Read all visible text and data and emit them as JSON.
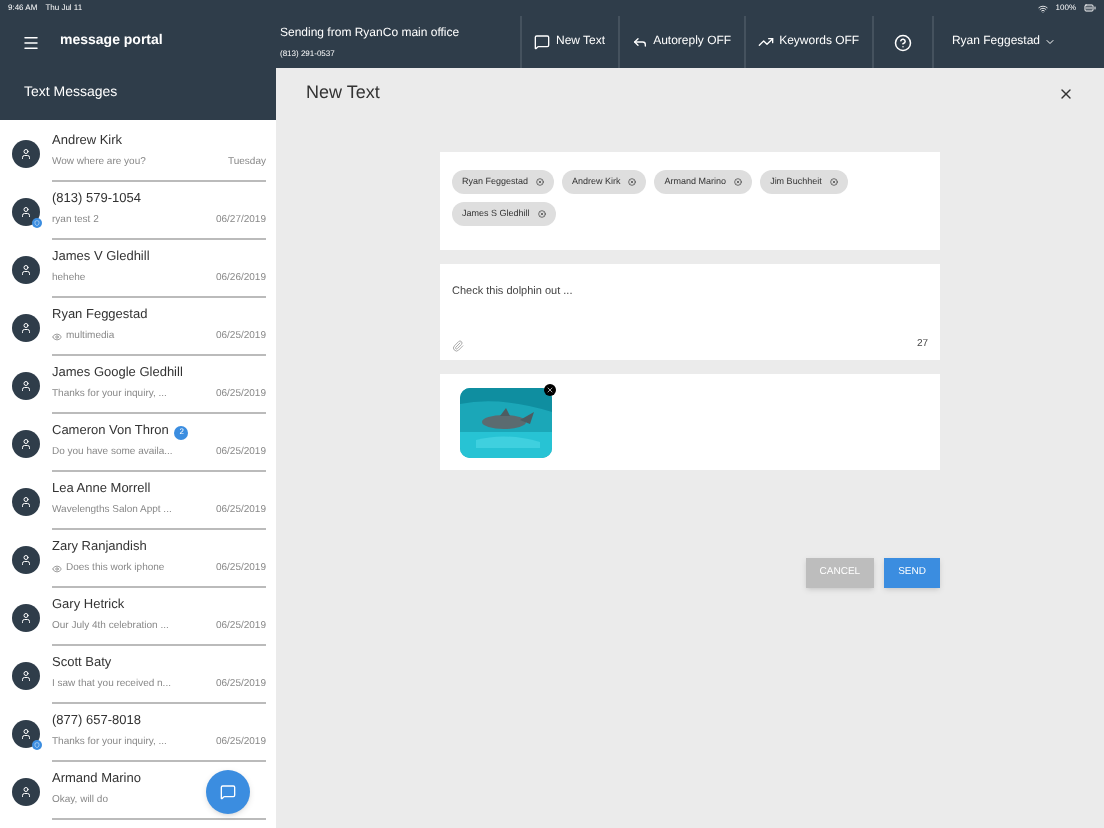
{
  "status_bar": {
    "time": "9:46 AM",
    "date": "Thu Jul 11",
    "battery": "100%"
  },
  "header": {
    "logo": "message portal",
    "sending_from": "Sending from RyanCo main office",
    "phone": "(813) 291-0537",
    "nav": [
      {
        "kind": "chat",
        "label": "New Text"
      },
      {
        "kind": "reply",
        "label": "Autoreply OFF"
      },
      {
        "kind": "keywords",
        "label": "Keywords OFF"
      }
    ],
    "user": "Ryan Feggestad"
  },
  "sidebar": {
    "title": "Text Messages",
    "items": [
      {
        "name": "Andrew Kirk",
        "preview": "Wow where are you?",
        "date": "Tuesday",
        "badge": false,
        "media": false
      },
      {
        "name": "(813) 579-1054",
        "preview": "ryan test 2",
        "date": "06/27/2019",
        "badge": true,
        "media": false
      },
      {
        "name": "James V Gledhill",
        "preview": "hehehe",
        "date": "06/26/2019",
        "badge": false,
        "media": false
      },
      {
        "name": "Ryan Feggestad",
        "preview": "multimedia",
        "date": "06/25/2019",
        "badge": false,
        "media": true
      },
      {
        "name": "James Google Gledhill",
        "preview": "Thanks for your inquiry, ...",
        "date": "06/25/2019",
        "badge": false,
        "media": false
      },
      {
        "name": "Cameron Von Thron",
        "unread": "2",
        "preview": "Do you have some availa...",
        "date": "06/25/2019",
        "badge": false,
        "media": false
      },
      {
        "name": "Lea Anne Morrell",
        "preview": "Wavelengths Salon Appt ...",
        "date": "06/25/2019",
        "badge": false,
        "media": false
      },
      {
        "name": "Zary Ranjandish",
        "preview": "Does this work iphone",
        "date": "06/25/2019",
        "badge": false,
        "media": true
      },
      {
        "name": "Gary Hetrick",
        "preview": "Our July 4th celebration ...",
        "date": "06/25/2019",
        "badge": false,
        "media": false
      },
      {
        "name": "Scott Baty",
        "preview": "I saw that you received n...",
        "date": "06/25/2019",
        "badge": false,
        "media": false
      },
      {
        "name": "(877) 657-8018",
        "preview": "Thanks for your inquiry, ...",
        "date": "06/25/2019",
        "badge": true,
        "media": false
      },
      {
        "name": "Armand Marino",
        "preview": "Okay, will do",
        "badge": false,
        "media": false
      }
    ]
  },
  "dialog": {
    "title": "New Text",
    "recipients": [
      "Ryan Feggestad",
      "Andrew Kirk",
      "Armand Marino",
      "Jim Buchheit",
      "James S Gledhill"
    ],
    "message": "Check this dolphin out ...",
    "count": "27",
    "buttons": [
      {
        "kind": "cancel",
        "label": "CANCEL"
      },
      {
        "kind": "send",
        "label": "SEND"
      }
    ]
  }
}
